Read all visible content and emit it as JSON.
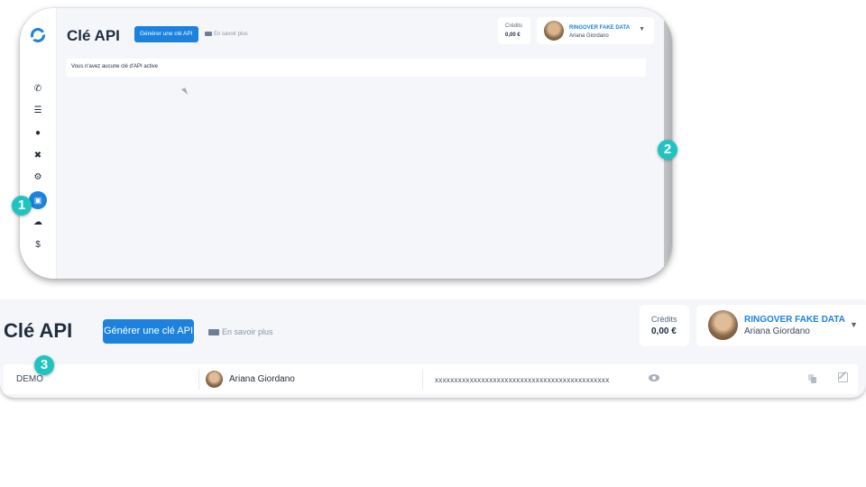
{
  "window_top": {
    "title": "Clé API",
    "generate_button": "Générer une clé API",
    "learn_more": "En savoir plus",
    "credits_label": "Crédits",
    "credits_value": "0,00 €",
    "company": "RINGOVER FAKE DATA",
    "user_name": "Ariana Giordano",
    "empty_message": "Vous n'avez aucune clé d'API active",
    "sidebar_icons": [
      "phone-icon",
      "list-icon",
      "globe-icon",
      "tools-icon",
      "gear-icon",
      "api-icon",
      "cloud-icon",
      "dollar-icon"
    ],
    "sidebar_dollar": "$"
  },
  "window_bottom": {
    "title": "Clé API",
    "generate_button": "Générer une clé API",
    "learn_more": "En savoir plus",
    "credits_label": "Crédits",
    "credits_value": "0,00 €",
    "company": "RINGOVER FAKE DATA",
    "user_name": "Ariana Giordano",
    "row": {
      "name": "DEMO",
      "owner": "Ariana Giordano",
      "key": "xxxxxxxxxxxxxxxxxxxxxxxxxxxxxxxxxxxxxxxxxxxxx"
    }
  },
  "badges": [
    "1",
    "2",
    "3"
  ],
  "colors": {
    "accent": "#1c82dd",
    "badge": "#1fc4c0",
    "background": "#f5f6f9"
  }
}
